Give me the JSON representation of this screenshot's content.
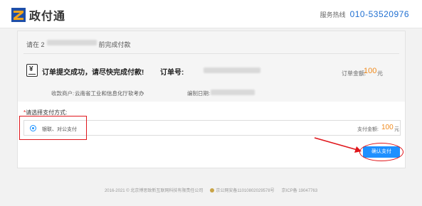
{
  "header": {
    "logo_text": "政付通",
    "hotline_label": "服务热线",
    "hotline_number": "010-53520976"
  },
  "order": {
    "pay_before_prefix": "请在 2",
    "pay_before_suffix": "前完成付款",
    "success_text": "订单提交成功，请尽快完成付款!",
    "order_no_label": "订单号:",
    "amount_label": "订单金额:",
    "amount_value": "100",
    "amount_unit": "元",
    "merchant_label": "收款商户:",
    "merchant_value": "云南省工业和信息化厅软考办",
    "date_label": "编制日期:"
  },
  "payment": {
    "title_star": "*",
    "title": "请选择支付方式:",
    "method_label": "银联、对公支付",
    "amount_label": "支付金额:",
    "amount_value": "100",
    "amount_unit": "元",
    "confirm_label": "确认支付"
  },
  "footer": {
    "copyright": "2016-2021 © 北京博思致新互联网科技有限责任公司",
    "police": "京公网安备11010802029578号",
    "icp": "京ICP备 19047763"
  },
  "colors": {
    "brand_blue": "#1f6fd1",
    "button_blue": "#1e90ff",
    "amount_orange": "#f08a1c",
    "annotation_red": "#e0161b"
  }
}
